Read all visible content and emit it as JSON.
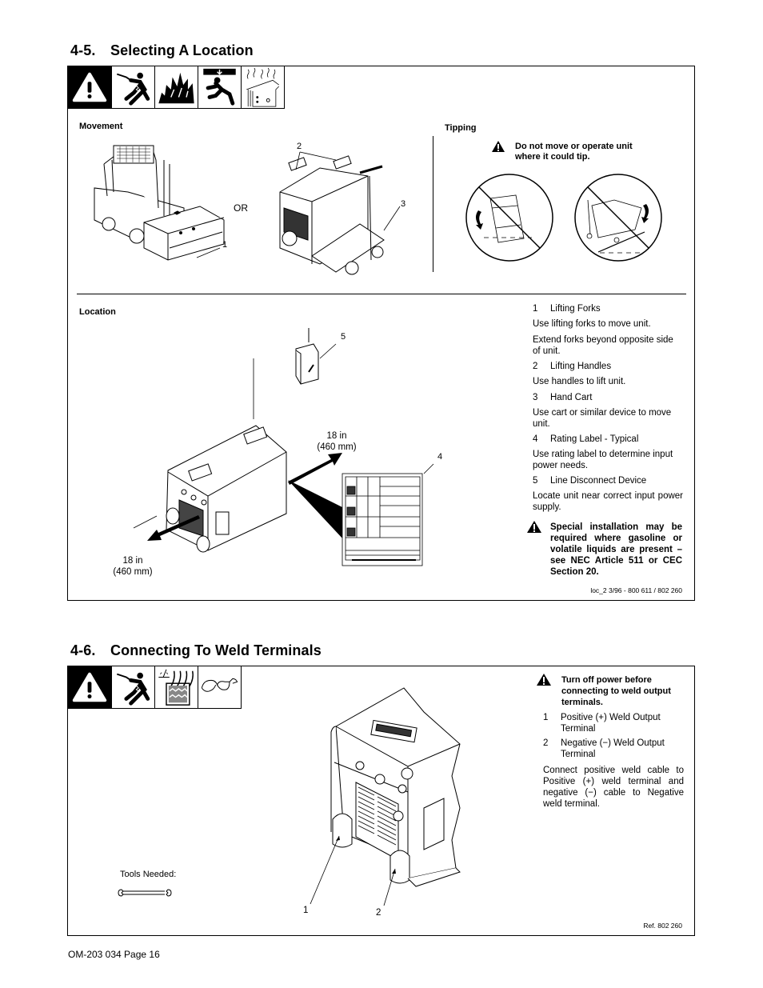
{
  "section_45": {
    "number": "4-5.",
    "title": "Selecting A Location",
    "hazard_icons": [
      "warning-icon",
      "electric-shock-icon",
      "fire-icon",
      "falling-equipment-icon",
      "hot-parts-icon"
    ],
    "movement": {
      "label": "Movement",
      "or_label": "OR",
      "callouts": [
        "1",
        "2",
        "3"
      ]
    },
    "tipping": {
      "label": "Tipping",
      "warning": "Do not move or operate unit where it could tip."
    },
    "location": {
      "label": "Location",
      "callouts": [
        "4",
        "5"
      ],
      "clearance_right": [
        "18 in",
        "(460 mm)"
      ],
      "clearance_left": [
        "18 in",
        "(460 mm)"
      ]
    },
    "legend": [
      {
        "num": "1",
        "title": "Lifting Forks",
        "paras": [
          "Use lifting forks to move unit.",
          "Extend forks beyond opposite side of unit."
        ]
      },
      {
        "num": "2",
        "title": "Lifting Handles",
        "paras": [
          "Use handles to lift unit."
        ]
      },
      {
        "num": "3",
        "title": "Hand Cart",
        "paras": [
          "Use cart or similar device to move unit."
        ]
      },
      {
        "num": "4",
        "title": "Rating Label - Typical",
        "paras": [
          "Use rating label to determine input power needs."
        ]
      },
      {
        "num": "5",
        "title": "Line Disconnect Device",
        "paras": [
          "Locate unit near correct input power supply."
        ]
      }
    ],
    "special_warning": "Special installation may be required where gasoline or volatile liquids are present – see NEC Article 511 or CEC Section 20.",
    "ref": "loc_2 3/96 - 800 611 / 802 260"
  },
  "section_46": {
    "number": "4-6.",
    "title": "Connecting To Weld Terminals",
    "hazard_icons": [
      "warning-icon",
      "electric-shock-icon",
      "arc-rays-icon",
      "safety-glasses-icon"
    ],
    "warning": "Turn off power before connecting to weld output terminals.",
    "legend": [
      {
        "num": "1",
        "title": "Positive (+) Weld Output Terminal"
      },
      {
        "num": "2",
        "title": "Negative (−) Weld Output Terminal"
      }
    ],
    "instruction": "Connect positive weld cable to Positive (+) weld terminal and negative (−) cable to Negative weld terminal.",
    "tools_label": "Tools Needed:",
    "tool_icon": "wrench-icon",
    "callouts": [
      "1",
      "2"
    ],
    "ref": "Ref. 802 260"
  },
  "footer": {
    "page_label": "OM-203 034 Page 16"
  }
}
